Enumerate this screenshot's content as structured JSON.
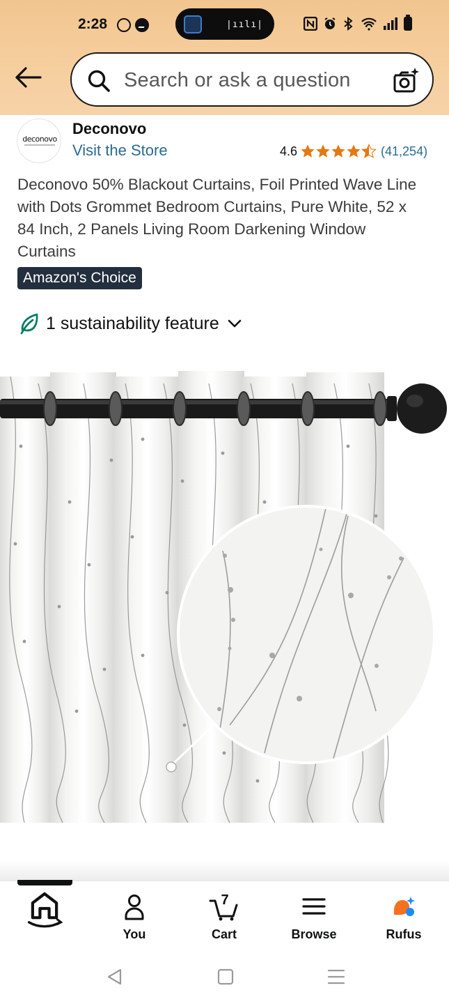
{
  "status_bar": {
    "time": "2:28",
    "left_icons": [
      "whatsapp-icon",
      "messenger-icon"
    ],
    "right_icons": [
      "nfc-icon",
      "alarm-icon",
      "bluetooth-icon",
      "wifi-icon",
      "signal-icon",
      "battery-icon"
    ]
  },
  "header": {
    "back_icon": "back-arrow-icon",
    "search_placeholder": "Search or ask a question",
    "camera_icon": "camera-sparkle-icon",
    "gradient_color": "#f2c58f"
  },
  "seller": {
    "logo_text": "deconovo",
    "name": "Deconovo",
    "visit_store": "Visit the Store",
    "rating": "4.6",
    "stars_filled": 4.5,
    "rating_count": "(41,254)",
    "star_color": "#e47911",
    "link_color": "#2a6b8f"
  },
  "product": {
    "title": "Deconovo 50% Blackout Curtains, Foil Printed Wave Line with Dots Grommet Bedroom Curtains, Pure White, 52 x 84 Inch, 2 Panels Living Room Darkening Window Curtains",
    "badge": "Amazon's Choice",
    "sustainability": "1 sustainability feature"
  },
  "bottom_nav": {
    "items": [
      {
        "label": "",
        "icon": "home-icon"
      },
      {
        "label": "You",
        "icon": "person-icon"
      },
      {
        "label": "Cart",
        "icon": "cart-icon",
        "count": "7"
      },
      {
        "label": "Browse",
        "icon": "menu-icon"
      },
      {
        "label": "Rufus",
        "icon": "rufus-icon"
      }
    ],
    "active_index": 0
  },
  "system_nav": [
    "back-triangle-icon",
    "home-square-icon",
    "recents-icon"
  ]
}
